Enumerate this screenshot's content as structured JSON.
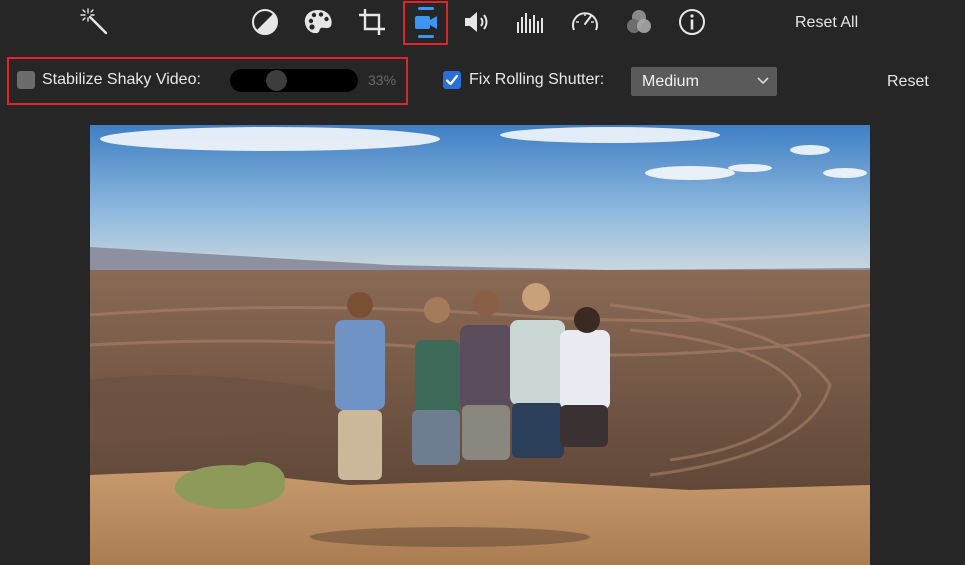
{
  "toolbar": {
    "tools": [
      {
        "id": "enhance",
        "icon": "magic-wand-icon"
      },
      {
        "id": "color-balance",
        "icon": "color-balance-icon"
      },
      {
        "id": "color-correction",
        "icon": "palette-icon"
      },
      {
        "id": "crop",
        "icon": "crop-icon"
      },
      {
        "id": "stabilization",
        "icon": "video-camera-icon",
        "selected": true
      },
      {
        "id": "volume",
        "icon": "speaker-icon"
      },
      {
        "id": "noise-reduction",
        "icon": "equalizer-icon"
      },
      {
        "id": "speed",
        "icon": "speedometer-icon"
      },
      {
        "id": "clip-filter",
        "icon": "filter-circles-icon"
      },
      {
        "id": "info",
        "icon": "info-icon"
      }
    ],
    "reset_all_label": "Reset All"
  },
  "stabilization": {
    "stabilize_label": "Stabilize Shaky Video:",
    "stabilize_checked": false,
    "stabilize_amount": 0.33,
    "stabilize_value": "33%",
    "rolling_shutter_label": "Fix Rolling Shutter:",
    "rolling_shutter_checked": true,
    "rolling_shutter_level": "Medium",
    "reset_label": "Reset"
  },
  "colors": {
    "background": "#262626",
    "highlight": "#e0242a",
    "accent": "#2a6fd6"
  }
}
